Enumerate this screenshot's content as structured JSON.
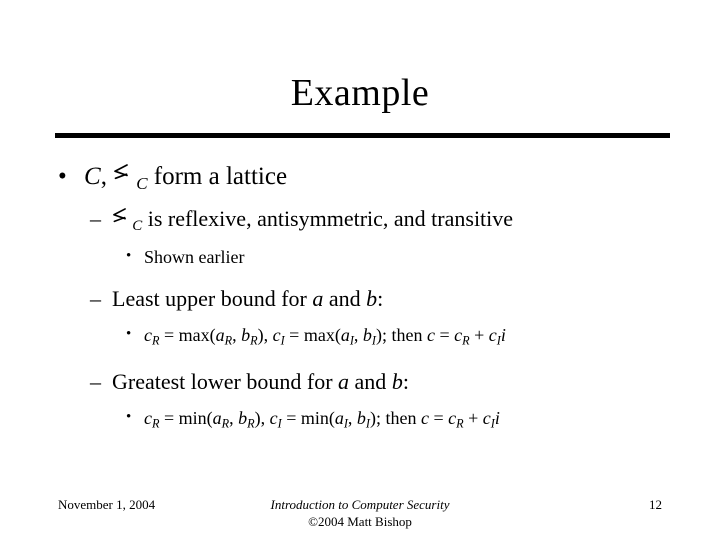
{
  "slide": {
    "title": "Example",
    "bullets": {
      "b1_pre": "C",
      "b1_comma": ", ",
      "b1_sub": "C",
      "b1_post": " form a lattice",
      "b2_sub": "C",
      "b2_post": " is reflexive, antisymmetric, and transitive",
      "b3": "Shown earlier",
      "b4_pre": "Least upper bound for ",
      "b4_a": "a",
      "b4_mid": " and ",
      "b4_b": "b",
      "b4_post": ":",
      "b5_c1": "c",
      "b5_c1sub": "R",
      "b5_eq1": " = max(",
      "b5_a1": "a",
      "b5_a1sub": "R",
      "b5_sep1": ", ",
      "b5_b1": "b",
      "b5_b1sub": "R",
      "b5_mid": "), ",
      "b5_c2": "c",
      "b5_c2sub": "I",
      "b5_eq2": " = max(",
      "b5_a2": "a",
      "b5_a2sub": "I",
      "b5_sep2": ", ",
      "b5_b2": "b",
      "b5_b2sub": "I",
      "b5_then": "); then ",
      "b5_c": "c",
      "b5_eq3": " = ",
      "b5_cR": "c",
      "b5_cRsub": "R",
      "b5_plus": " + ",
      "b5_cI": "c",
      "b5_cIsub": "I",
      "b5_i": "i",
      "b6_pre": "Greatest lower bound for ",
      "b6_a": "a",
      "b6_mid": " and ",
      "b6_b": "b",
      "b6_post": ":",
      "b7_c1": "c",
      "b7_c1sub": "R",
      "b7_eq1": " = min(",
      "b7_a1": "a",
      "b7_a1sub": "R",
      "b7_sep1": ", ",
      "b7_b1": "b",
      "b7_b1sub": "R",
      "b7_mid": "), ",
      "b7_c2": "c",
      "b7_c2sub": "I",
      "b7_eq2": " = min(",
      "b7_a2": "a",
      "b7_a2sub": "I",
      "b7_sep2": ", ",
      "b7_b2": "b",
      "b7_b2sub": "I",
      "b7_then": "); then ",
      "b7_c": "c",
      "b7_eq3": " = ",
      "b7_cR": "c",
      "b7_cRsub": "R",
      "b7_plus": " + ",
      "b7_cI": "c",
      "b7_cIsub": "I",
      "b7_i": "i"
    },
    "markers": {
      "level1": "•",
      "level2": "–",
      "level3": "•"
    },
    "footer": {
      "date": "November 1, 2004",
      "subtitle": "Introduction to Computer Security",
      "copyright": "©2004 Matt Bishop",
      "page": "12"
    },
    "colors": {
      "text": "#000000",
      "background": "#ffffff",
      "rule": "#000000"
    }
  }
}
